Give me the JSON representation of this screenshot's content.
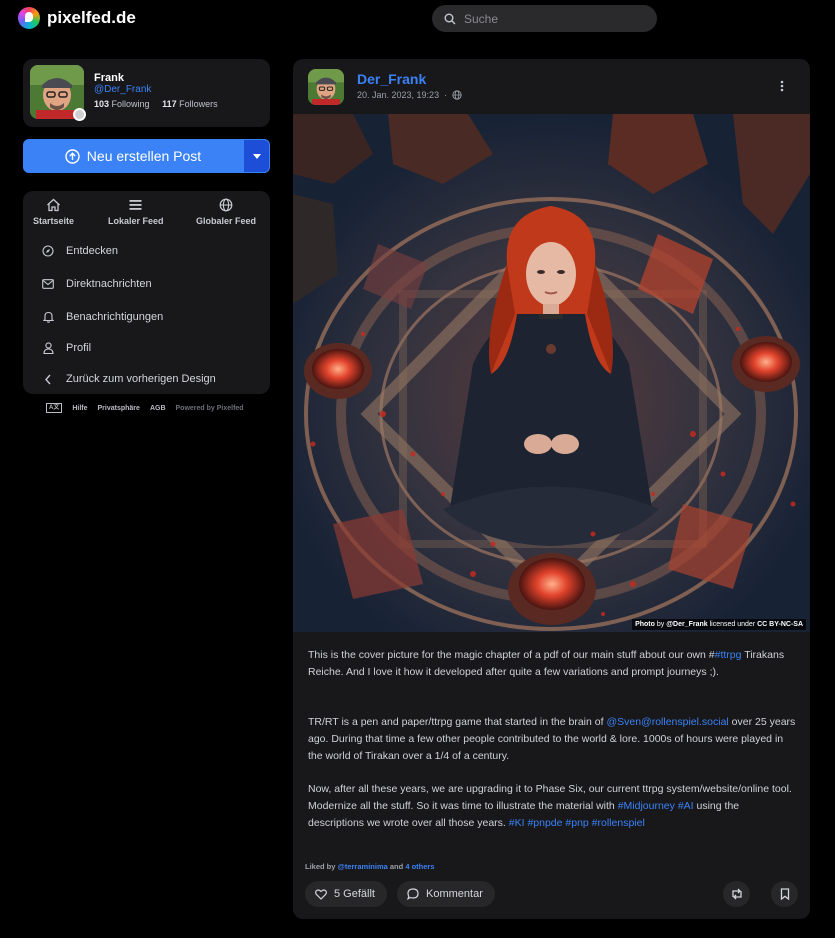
{
  "brand": {
    "name": "pixelfed.de"
  },
  "search": {
    "placeholder": "Suche"
  },
  "profile": {
    "name": "Frank",
    "handle": "@Der_Frank",
    "following_count": "103",
    "following_label": "Following",
    "followers_count": "117",
    "followers_label": "Followers"
  },
  "new_post": {
    "label": "Neu erstellen Post"
  },
  "feeds": [
    {
      "label": "Startseite",
      "icon": "home-icon"
    },
    {
      "label": "Lokaler Feed",
      "icon": "list-icon"
    },
    {
      "label": "Globaler Feed",
      "icon": "globe-icon"
    }
  ],
  "nav": [
    {
      "label": "Entdecken",
      "icon": "compass-icon"
    },
    {
      "label": "Direktnachrichten",
      "icon": "envelope-icon"
    },
    {
      "label": "Benachrichtigungen",
      "icon": "bell-icon"
    },
    {
      "label": "Profil",
      "icon": "user-icon"
    },
    {
      "label": "Zurück zum vorherigen Design",
      "icon": "chevron-left-icon"
    }
  ],
  "footer": {
    "lang": "A文",
    "help": "Hilfe",
    "privacy": "Privatsphäre",
    "terms": "AGB",
    "powered": "Powered by Pixelfed"
  },
  "post": {
    "username": "Der_Frank",
    "date": "20. Jan. 2023, 19:23",
    "separator": "·",
    "visibility_icon": "globe-icon",
    "credit": {
      "prefix": "Photo",
      "by": "by",
      "author": "@Der_Frank",
      "licensed": "licensed under",
      "license": "CC BY-NC-SA"
    },
    "p1": {
      "text": "This is the cover picture for the magic chapter of a pdf of our main stuff about our own #",
      "tag": "#ttrpg",
      "rest": "Tirakans Reiche. And I love it how it developed after quite a few variations and prompt journeys ;)."
    },
    "p2": {
      "a": "TR/RT is a pen and paper/ttrpg game that started in the brain of ",
      "mention": "@Sven@rollenspiel.social",
      "b": " over 25 years ago. During that time a few other people contributed to the world & lore. 1000s of hours were played in the world of Tirakan over a 1/4 of a century."
    },
    "p3": {
      "a": "Now, after all these years, we are upgrading it to Phase Six, our current ttrpg system/website/online tool. Modernize all the stuff. So it was time to illustrate the material with ",
      "tag_midjourney": "#Midjourney",
      "tag_ai": "#AI",
      "b": " using the descriptions we wrote over all those years. ",
      "tags_end": "#KI #pnpde #pnp #rollenspiel"
    },
    "liked": {
      "prefix": "Liked by",
      "user": "@terraminima",
      "and": "and",
      "others": "4 others"
    },
    "like_label": "5 Gefällt",
    "comment_label": "Kommentar"
  }
}
